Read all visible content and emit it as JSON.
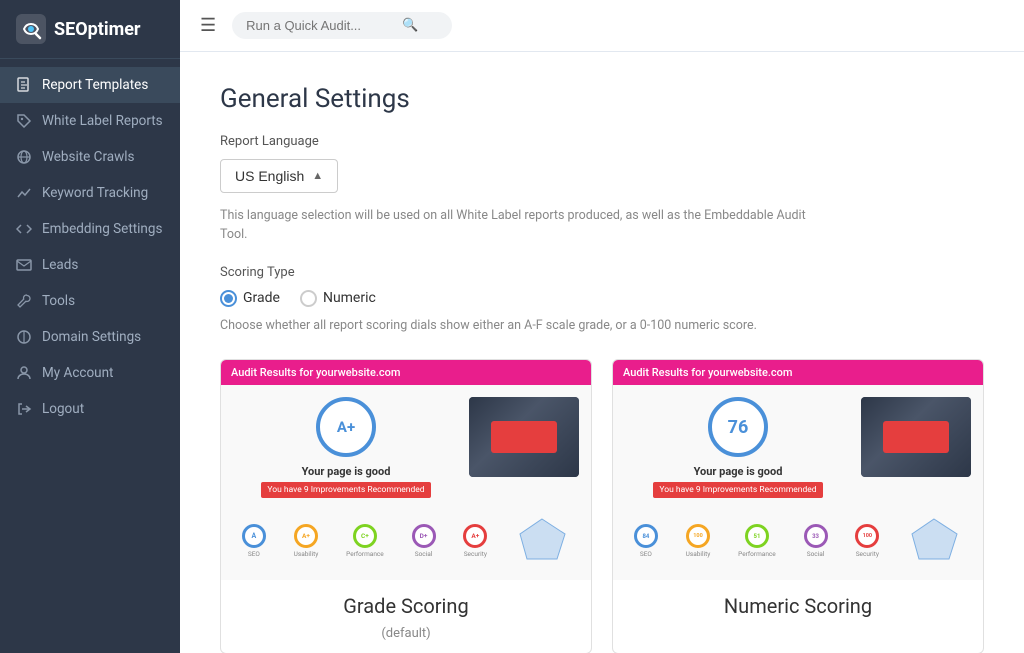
{
  "app": {
    "logo_text": "SEOptimer"
  },
  "topbar": {
    "search_placeholder": "Run a Quick Audit..."
  },
  "sidebar": {
    "items": [
      {
        "id": "report-templates",
        "label": "Report Templates",
        "active": true
      },
      {
        "id": "white-label-reports",
        "label": "White Label Reports",
        "active": false
      },
      {
        "id": "website-crawls",
        "label": "Website Crawls",
        "active": false
      },
      {
        "id": "keyword-tracking",
        "label": "Keyword Tracking",
        "active": false
      },
      {
        "id": "embedding-settings",
        "label": "Embedding Settings",
        "active": false
      },
      {
        "id": "leads",
        "label": "Leads",
        "active": false
      },
      {
        "id": "tools",
        "label": "Tools",
        "active": false
      },
      {
        "id": "domain-settings",
        "label": "Domain Settings",
        "active": false
      },
      {
        "id": "my-account",
        "label": "My Account",
        "active": false
      },
      {
        "id": "logout",
        "label": "Logout",
        "active": false
      }
    ]
  },
  "page": {
    "title": "General Settings",
    "report_language_label": "Report Language",
    "language_value": "US English",
    "language_info": "This language selection will be used on all White Label reports produced, as well as the Embeddable Audit Tool.",
    "scoring_type_label": "Scoring Type",
    "scoring_options": [
      {
        "id": "grade",
        "label": "Grade",
        "selected": true
      },
      {
        "id": "numeric",
        "label": "Numeric",
        "selected": false
      }
    ],
    "scoring_info": "Choose whether all report scoring dials show either an A-F scale grade, or a 0-100 numeric score.",
    "cards": [
      {
        "id": "grade-card",
        "banner": "Audit Results for yourwebsite.com",
        "score": "A+",
        "score_type": "grade",
        "good_text": "Your page is good",
        "improvements": "You have 9 Improvements Recommended",
        "caption": "Grade Scoring",
        "sub_caption": "(default)",
        "circles": [
          {
            "label": "SEO",
            "value": "A",
            "color": "#4a90d9"
          },
          {
            "label": "Usability",
            "value": "A+",
            "color": "#f5a623"
          },
          {
            "label": "Performance",
            "value": "C+",
            "color": "#7ed321"
          },
          {
            "label": "Social",
            "value": "D+",
            "color": "#9b59b6"
          },
          {
            "label": "Security",
            "value": "A+",
            "color": "#e53e3e"
          }
        ]
      },
      {
        "id": "numeric-card",
        "banner": "Audit Results for yourwebsite.com",
        "score": "76",
        "score_type": "numeric",
        "good_text": "Your page is good",
        "improvements": "You have 9 Improvements Recommended",
        "caption": "Numeric Scoring",
        "sub_caption": "",
        "circles": [
          {
            "label": "SEO",
            "value": "84",
            "color": "#4a90d9"
          },
          {
            "label": "Usability",
            "value": "100",
            "color": "#f5a623"
          },
          {
            "label": "Performance",
            "value": "51",
            "color": "#7ed321"
          },
          {
            "label": "Social",
            "value": "33",
            "color": "#9b59b6"
          },
          {
            "label": "Security",
            "value": "100",
            "color": "#e53e3e"
          }
        ]
      }
    ]
  }
}
